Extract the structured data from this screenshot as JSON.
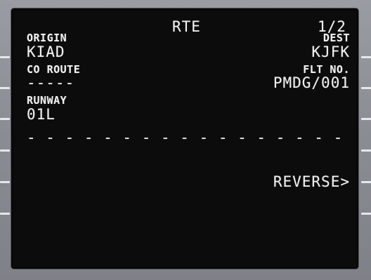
{
  "page": {
    "title": "RTE",
    "page_number": "1/2"
  },
  "left": {
    "origin_label": "ORIGIN",
    "origin_value": "KIAD",
    "co_route_label": "CO ROUTE",
    "co_route_value": "-----",
    "runway_label": "RUNWAY",
    "runway_value": "01L"
  },
  "right": {
    "dest_label": "DEST",
    "dest_value": "KJFK",
    "flt_no_label": "FLT NO.",
    "flt_no_value": "PMDG/001",
    "reverse_prompt": "REVERSE>"
  },
  "separator": "- - - - - - - - - - - - - - - - - - - - - - - - - - - - - -",
  "colors": {
    "screen_background": "#0c0c0c",
    "text": "#f2f2f2",
    "bezel": "#8e9097"
  }
}
